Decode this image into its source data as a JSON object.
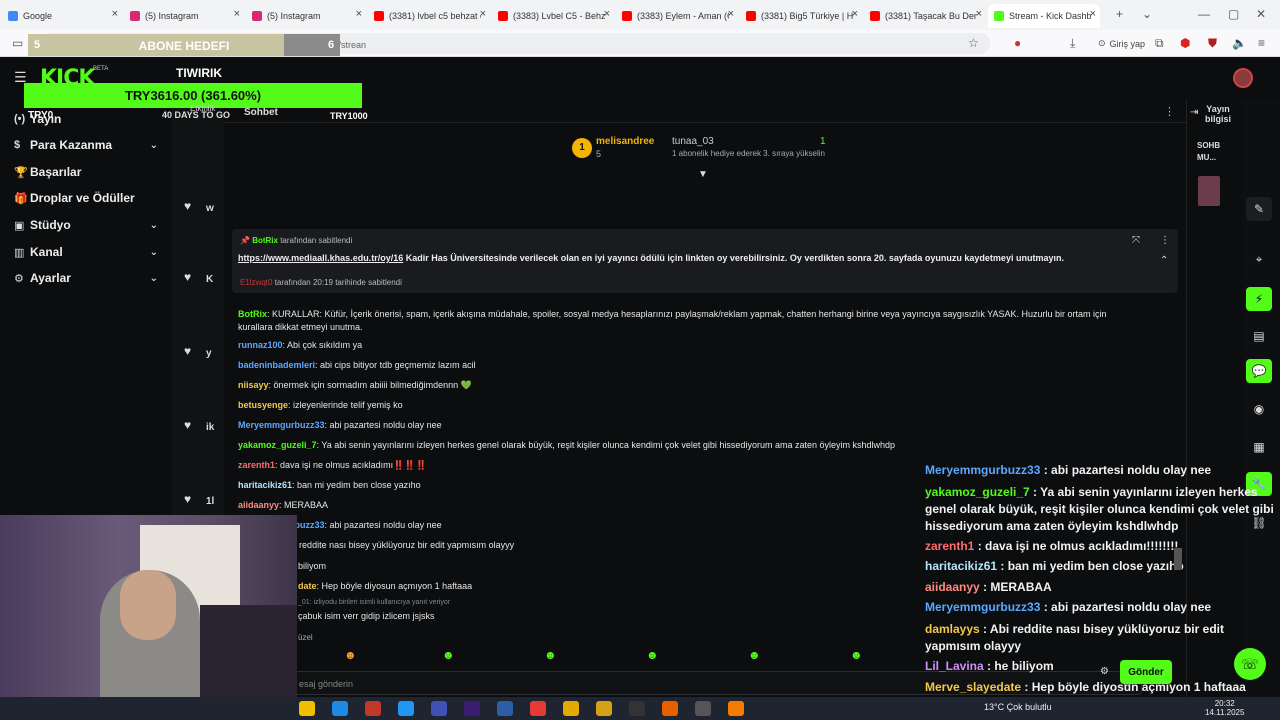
{
  "browser": {
    "tabs": [
      {
        "label": "Google",
        "color": "#4285f4"
      },
      {
        "label": "(5) Instagram",
        "color": "#d62976"
      },
      {
        "label": "(5) Instagram",
        "color": "#d62976"
      },
      {
        "label": "(3381) lvbel c5 behzat ç",
        "color": "#ff0000"
      },
      {
        "label": "(3383) Lvbel C5 - Behzat",
        "color": "#ff0000"
      },
      {
        "label": "(3383) Eylem - Aman (C",
        "color": "#ff0000"
      },
      {
        "label": "(3381) Big5 Türkiye | Ha",
        "color": "#ff0000"
      },
      {
        "label": "(3381) Taşacak Bu Deniz",
        "color": "#ff0000"
      },
      {
        "label": "Stream - Kick Dashboard",
        "color": "#53fc18"
      }
    ],
    "url_visible": "om/strean",
    "login_label": "Giriş yap"
  },
  "overlay": {
    "abone_label": "ABONE HEDEFI",
    "abone_start": "5",
    "abone_end": "6",
    "abone_progress": 0.82,
    "streamer_name": "TIWIRIK",
    "goal_text": "TRY3616.00 (361.60%)",
    "goal_progress": 1.0,
    "goal_min": "TRY0",
    "goal_days": "40 DAYS TO GO",
    "goal_max": "TRY1000",
    "etkinlik": "Etkinlik"
  },
  "kick": {
    "logo": "KICK",
    "beta": "BETA",
    "sidebar": [
      {
        "label": "Yayın",
        "icon": "(•)"
      },
      {
        "label": "Para Kazanma",
        "icon": "$",
        "chev": true
      },
      {
        "label": "Başarılar",
        "icon": "🏆"
      },
      {
        "label": "Droplar ve Ödüller",
        "icon": "🎁"
      },
      {
        "label": "Stüdyo",
        "icon": "▣",
        "chev": true
      },
      {
        "label": "Kanal",
        "icon": "▥",
        "chev": true
      },
      {
        "label": "Ayarlar",
        "icon": "⚙",
        "chev": true
      }
    ],
    "follow": [
      {
        "letter": "w"
      },
      {
        "letter": "K"
      },
      {
        "letter": "y"
      },
      {
        "letter": "ik"
      },
      {
        "letter": "1l"
      }
    ]
  },
  "chat": {
    "title": "Sohbet",
    "leader1_name": "melisandree",
    "leader1_count": "5",
    "leader2_name": "tunaa_03",
    "leader2_count": "1",
    "leader2_note": "1 abonelik hediye ederek 3. sıraya yükselin",
    "pin_user": "BotRix",
    "pin_suffix": "tarafından sabitlendi",
    "pin_link": "https://www.mediaall.khas.edu.tr/oy/16",
    "pin_text": " Kadir Has Üniversitesinde verilecek olan en iyi yayıncı ödülü için linkten oy verebilirsiniz. Oy verdikten sonra 20. sayfada oyunuzu kaydetmeyi unutmayın.",
    "pin_by_user": "E1lzwqt0",
    "pin_by_text": "tarafından 20:19 tarihinde sabitlendi",
    "rules_user": "BotRix",
    "rules_text": "KURALLAR: Küfür, İçerik önerisi, spam, içerik akışına müdahale, spoiler, sosyal medya hesaplarınızı paylaşmak/reklam yapmak, chatten herhangi birine veya yayıncıya saygısızlık YASAK. Huzurlu bir ortam için",
    "rules_text2": "kurallara dikkat etmeyi unutma.",
    "messages": [
      {
        "user": "runnaz100",
        "text": "Abi çok sıkıldım ya",
        "color": "#5ea7ff"
      },
      {
        "user": "badeninbademleri",
        "text": "abi cips bitiyor tdb geçmemiz lazım acil",
        "color": "#5ea7ff"
      },
      {
        "user": "niisayy",
        "text": "önermek için sormadım abiiii bilmediğimdennn 💚",
        "color": "#f2c94c"
      },
      {
        "user": "betusyenge",
        "text": "izleyenlerinde telif yemiş ko",
        "color": "#f2c94c"
      },
      {
        "user": "Meryemmgurbuzz33",
        "text": "abi pazartesi noldu olay nee",
        "color": "#5ea7ff"
      },
      {
        "user": "yakamoz_guzeli_7",
        "text": "Ya abi senin yayınlarını izleyen herkes genel olarak büyük, reşit kişiler olunca kendimi çok velet gibi hissediyorum ama zaten öyleyim kshdlwhdp",
        "color": "#53fc18"
      },
      {
        "user": "zarenth1",
        "text": "dava işi ne olmus acıkladımı‼️‼️‼️",
        "color": "#ff6b6b"
      },
      {
        "user": "haritacikiz61",
        "text": "ban mi yedim ben close yazıho",
        "color": "#b3e5fc"
      },
      {
        "user": "aiidaanyy",
        "text": "MERABAA",
        "color": "#ff8a80"
      },
      {
        "user": "Meryemmgurbuzz33",
        "text": "abi pazartesi noldu olay nee",
        "color": "#5ea7ff"
      },
      {
        "user": "damlayys",
        "text": "Abi reddite nası bisey yüklüyoruz bir edit yapmısım olayyy",
        "color": "#f2c94c"
      }
    ],
    "partial1": "biliyom",
    "partial2_user": "date",
    "partial2_text": "Hep böyle diyosun açmıyon 1 haftaaa",
    "partial3": "_01: izliyodu birileri isimli kullanıcıya yanıt veriyor",
    "partial4": "çabuk isim verr gidip izlicem jsjsks",
    "partial5": "üzel",
    "input_placeholder": "esaj gönderin"
  },
  "rail": {
    "yayin": "Yayın bilgisi",
    "sohb": "SOHB MU..."
  },
  "overlay_chat": {
    "lines": [
      {
        "user": "Meryemmgurbuzz33",
        "text": " : abi pazartesi noldu olay nee",
        "color": "#5ea7ff"
      },
      {
        "user": "yakamoz_guzeli_7",
        "text": " : Ya abi senin yayınlarını izleyen herkes genel olarak büyük, reşit kişiler olunca kendimi çok velet gibi hissediyorum ama zaten öyleyim kshdlwhdp",
        "color": "#53fc18"
      },
      {
        "user": "zarenth1",
        "text": " : dava işi ne olmus acıkladımı!!!!!!!!",
        "color": "#ff6b6b"
      },
      {
        "user": "haritacikiz61",
        "text": " : ban mi yedim ben close yazıho",
        "color": "#b3e5fc"
      },
      {
        "user": "aiidaanyy",
        "text": " : MERABAA",
        "color": "#ff8a80"
      },
      {
        "user": "Meryemmgurbuzz33",
        "text": " : abi pazartesi noldu olay nee",
        "color": "#5ea7ff"
      },
      {
        "user": "damlayys",
        "text": " : Abi reddite nası bisey yüklüyoruz bir edit yapmısım olayyy",
        "color": "#f2c94c"
      },
      {
        "user": "Lil_Lavina",
        "text": " : he biliyom",
        "color": "#d48cff"
      },
      {
        "user": "Merve_slayedate",
        "text": " : Hep böyle diyosun açmıyon 1 haftaaa",
        "color": "#f2c94c"
      }
    ],
    "send_label": "Gönder"
  },
  "taskbar": {
    "weather": "13°C  Çok bulutlu",
    "time": "20:32",
    "date": "14.11.2025"
  }
}
